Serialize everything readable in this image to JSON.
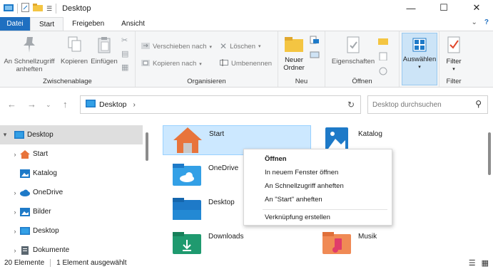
{
  "window": {
    "title": "Desktop",
    "controls": [
      "minimize-icon",
      "maximize-icon",
      "close-icon"
    ]
  },
  "ribbon_tabs": {
    "file": "Datei",
    "start": "Start",
    "share": "Freigeben",
    "view": "Ansicht"
  },
  "ribbon": {
    "clipboard": {
      "pin": "An Schnellzugriff anheften",
      "copy": "Kopieren",
      "paste": "Einfügen",
      "label": "Zwischenablage"
    },
    "organize": {
      "move": "Verschieben nach",
      "copy_to": "Kopieren nach",
      "delete": "Löschen",
      "rename": "Umbenennen",
      "label": "Organisieren"
    },
    "new": {
      "new_folder": "Neuer Ordner",
      "label": "Neu"
    },
    "open": {
      "properties": "Eigenschaften",
      "label": "Öffnen"
    },
    "select": {
      "select": "Auswählen"
    },
    "filter": {
      "filter": "Filter",
      "label": "Filter"
    }
  },
  "address": {
    "path": "Desktop",
    "search_placeholder": "Desktop durchsuchen"
  },
  "sidebar": {
    "items": [
      {
        "label": "Desktop"
      },
      {
        "label": "Start"
      },
      {
        "label": "Katalog"
      },
      {
        "label": "OneDrive"
      },
      {
        "label": "Bilder"
      },
      {
        "label": "Desktop"
      },
      {
        "label": "Dokumente"
      }
    ]
  },
  "content": {
    "items": [
      {
        "label": "Start"
      },
      {
        "label": "Katalog"
      },
      {
        "label": "OneDrive"
      },
      {
        "label": "Desktop"
      },
      {
        "label": "Downloads"
      },
      {
        "label": "Musik"
      }
    ]
  },
  "context_menu": {
    "items": [
      "Öffnen",
      "In neuem Fenster öffnen",
      "An Schnellzugriff anheften",
      "An \"Start\" anheften",
      "Verknüpfung erstellen"
    ]
  },
  "status": {
    "count": "20 Elemente",
    "selection": "1 Element ausgewählt"
  },
  "colors": {
    "accent": "#1f6fc0",
    "selection": "#cce8ff",
    "folder_yellow": "#f4c542",
    "folder_blue": "#1e7ac8"
  }
}
